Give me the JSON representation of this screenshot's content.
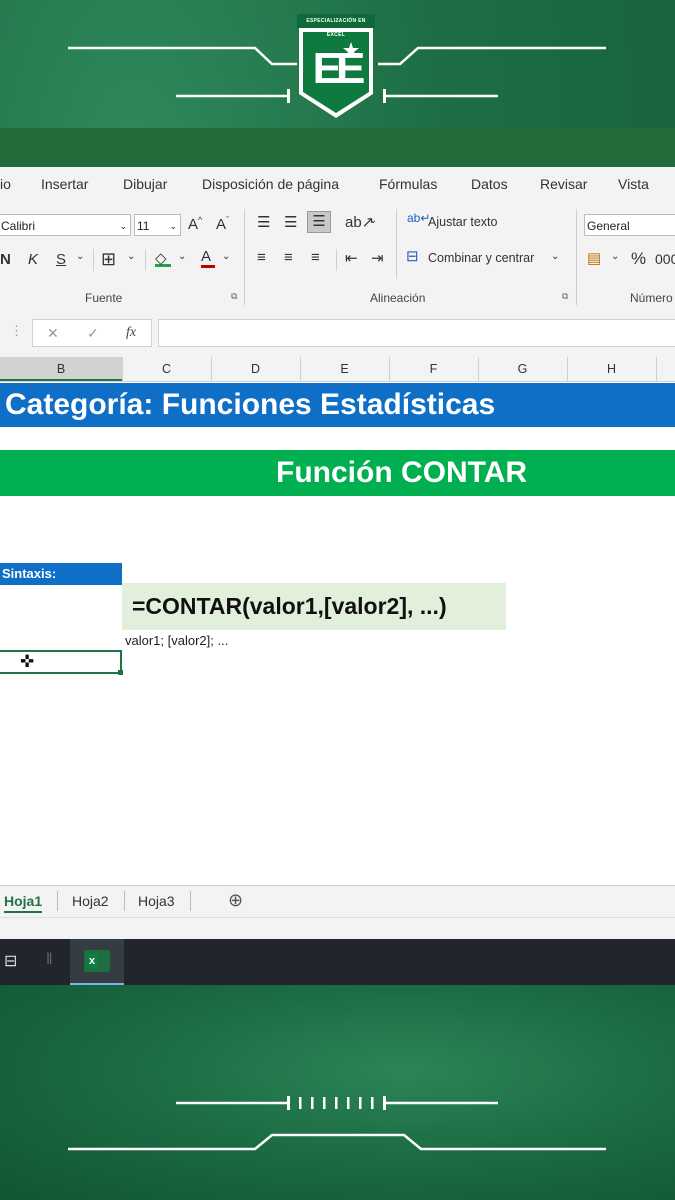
{
  "branding": {
    "logo_caption": "ESPECIALIZACIÓN EN EXCEL",
    "logo_letters": "EE"
  },
  "menu": {
    "tabs": [
      "io",
      "Insertar",
      "Dibujar",
      "Disposición de página",
      "Fórmulas",
      "Datos",
      "Revisar",
      "Vista"
    ]
  },
  "ribbon": {
    "font_name": "Calibri",
    "font_size": "11",
    "wrap_text": "Ajustar texto",
    "merge_center": "Combinar y centrar",
    "number_format": "General",
    "group_font": "Fuente",
    "group_alignment": "Alineación",
    "group_number": "Número",
    "bold": "N",
    "italic": "K",
    "underline": "S",
    "grow_font": "A",
    "shrink_font": "A",
    "font_color": "A",
    "percent": "%"
  },
  "formula_bar": {
    "fx": "fx",
    "cancel": "✕",
    "enter": "✓",
    "content": ""
  },
  "columns": [
    "B",
    "C",
    "D",
    "E",
    "F",
    "G",
    "H"
  ],
  "sheet": {
    "category_banner": "Categoría: Funciones Estadísticas",
    "function_banner": "Función CONTAR",
    "syntax_label": "Sintaxis:",
    "formula": "=CONTAR(valor1,[valor2], ...)",
    "args": "valor1; [valor2]; ..."
  },
  "sheet_tabs": [
    "Hoja1",
    "Hoja2",
    "Hoja3"
  ],
  "add_sheet": "⊕",
  "colors": {
    "category_banner": "#0f6fc6",
    "function_banner": "#00b050",
    "formula_bg": "#e2efda",
    "excel_green": "#217346"
  }
}
